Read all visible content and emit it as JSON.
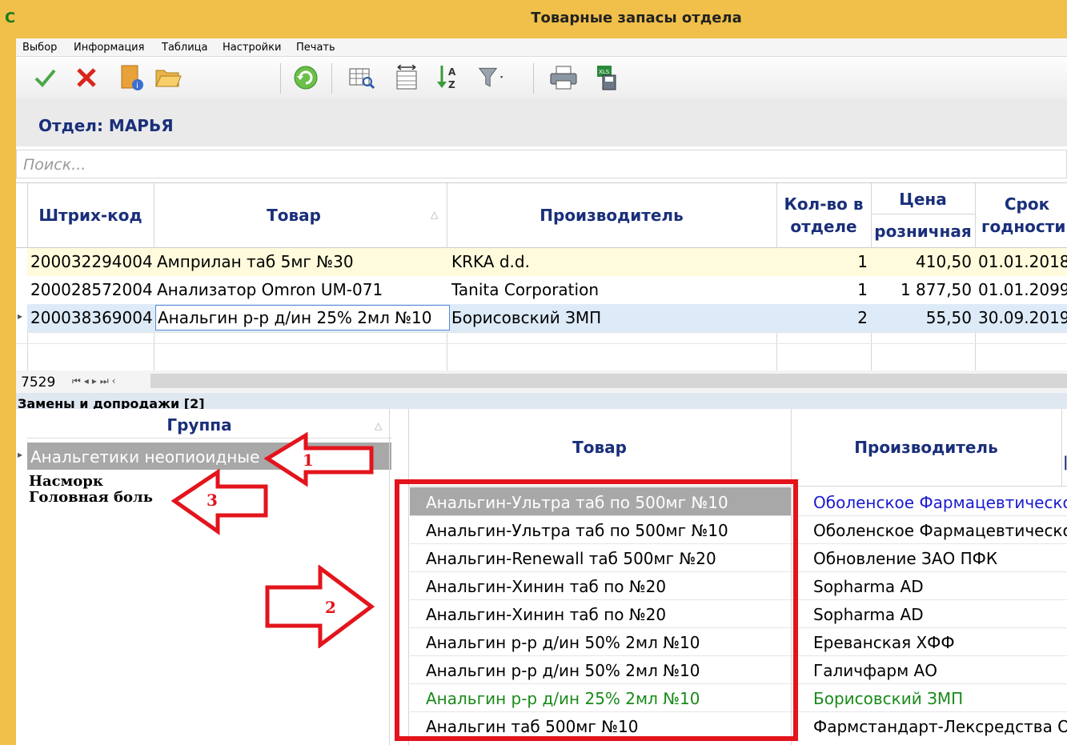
{
  "window": {
    "title": "Товарные запасы отдела",
    "app_icon": "C"
  },
  "menu": [
    "Выбор",
    "Информация",
    "Таблица",
    "Настройки",
    "Печать"
  ],
  "toolbar": {
    "icons": [
      "check-icon",
      "close-icon",
      "card-info-icon",
      "folder-open-icon",
      "refresh-icon",
      "table-search-icon",
      "column-width-icon",
      "sort-az-icon",
      "filter-icon",
      "print-icon",
      "excel-save-icon"
    ]
  },
  "department": {
    "label": "Отдел: МАРЬЯ"
  },
  "search": {
    "placeholder": "Поиск..."
  },
  "main_grid": {
    "headers": {
      "barcode": "Штрих-код",
      "product": "Товар",
      "manufacturer": "Производитель",
      "qty_line1": "Кол-во в",
      "qty_line2": "отделе",
      "price_line1": "Цена",
      "price_line2": "розничная",
      "expiry_line1": "Срок",
      "expiry_line2": "годности"
    },
    "rows": [
      {
        "barcode": "200032294004",
        "product": "Амприлан таб 5мг №30",
        "manufacturer": "KRKA d.d.",
        "qty": "1",
        "price": "410,50",
        "expiry": "01.01.2018"
      },
      {
        "barcode": "200028572004",
        "product": "Анализатор Omron UM-071",
        "manufacturer": "Tanita Corporation",
        "qty": "1",
        "price": "1 877,50",
        "expiry": "01.01.2099"
      },
      {
        "barcode": "200038369004",
        "product": "Анальгин р-р д/ин 25% 2мл №10",
        "manufacturer": "Борисовский ЗМП",
        "qty": "2",
        "price": "55,50",
        "expiry": "30.09.2019"
      }
    ],
    "record_count": "7529"
  },
  "lower": {
    "section_title": "Замены и допродажи [2]",
    "group_header": "Группа",
    "groups": [
      "Анальгетики неопиоидные",
      "Насморк",
      "Головная боль"
    ],
    "product_header": "Товар",
    "manufacturer_header": "Производитель",
    "rows": [
      {
        "product": "Анальгин-Ультра таб по 500мг №10",
        "manufacturer": "Оболенское Фармацевтическо"
      },
      {
        "product": "Анальгин-Ультра таб по 500мг №10",
        "manufacturer": "Оболенское Фармацевтическо"
      },
      {
        "product": "Анальгин-Renewall таб 500мг №20",
        "manufacturer": "Обновление ЗАО ПФК"
      },
      {
        "product": "Анальгин-Хинин таб по №20",
        "manufacturer": "Sopharma AD"
      },
      {
        "product": "Анальгин-Хинин таб по №20",
        "manufacturer": "Sopharma AD"
      },
      {
        "product": "Анальгин р-р д/ин 50% 2мл №10",
        "manufacturer": "Ереванская ХФФ"
      },
      {
        "product": "Анальгин р-р д/ин 50% 2мл №10",
        "manufacturer": "Галичфарм АО"
      },
      {
        "product": "Анальгин р-р д/ин 25% 2мл №10",
        "manufacturer": "Борисовский ЗМП"
      },
      {
        "product": "Анальгин таб 500мг №10",
        "manufacturer": "Фармстандарт-Лексредства О."
      }
    ]
  },
  "annotations": [
    "1",
    "2",
    "3"
  ],
  "colors": {
    "accent": "#f0c04a",
    "header_text": "#1a2f7a",
    "annotation_red": "#e3141c",
    "link_blue": "#1a1ad0",
    "current_green": "#1a8a1a"
  }
}
